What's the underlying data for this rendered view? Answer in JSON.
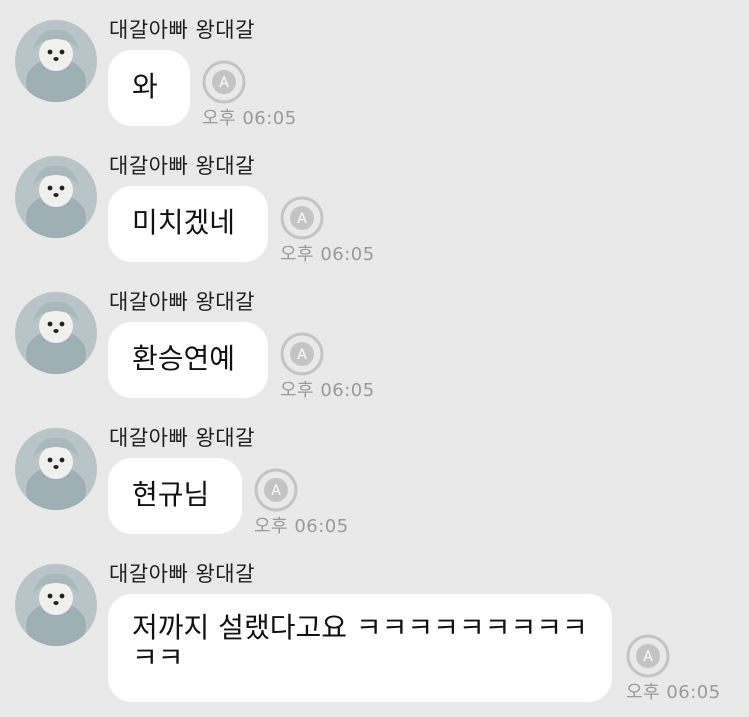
{
  "messages": [
    {
      "sender": "대갈아빠 왕대갈",
      "text": "와",
      "time": "오후 06:05"
    },
    {
      "sender": "대갈아빠 왕대갈",
      "text": "미치겠네",
      "time": "오후 06:05"
    },
    {
      "sender": "대갈아빠 왕대갈",
      "text": "환승연예",
      "time": "오후 06:05"
    },
    {
      "sender": "대갈아빠 왕대갈",
      "text": "현규님",
      "time": "오후 06:05"
    },
    {
      "sender": "대갈아빠 왕대갈",
      "text": "저까지 설랬다고요 ㅋㅋㅋㅋㅋㅋㅋㅋㅋㅋㅋ",
      "time": "오후 06:05"
    }
  ],
  "icons": {
    "avatar": "dog-in-hoodie-avatar",
    "translate": "translate-icon"
  },
  "colors": {
    "background": "#e9e9e9",
    "bubble": "#ffffff",
    "time_text": "#9a9a9a",
    "icon": "#c4c4c4"
  }
}
